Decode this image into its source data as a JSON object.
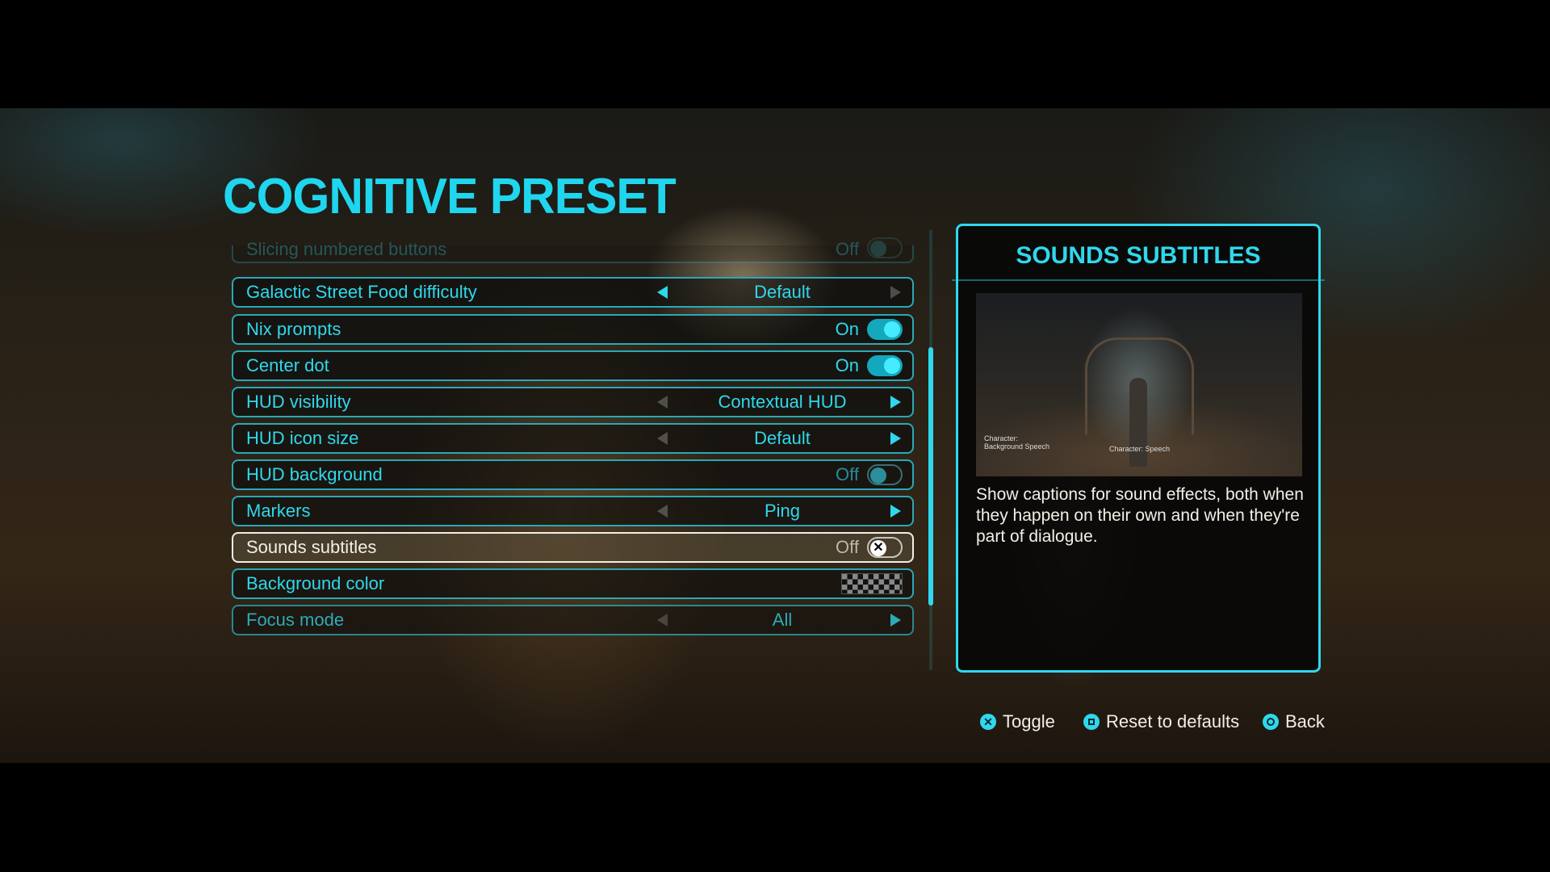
{
  "page": {
    "title": "COGNITIVE PRESET"
  },
  "settings": [
    {
      "label": "Slicing numbered buttons",
      "type": "toggle",
      "state": "Off"
    },
    {
      "label": "Galactic Street Food difficulty",
      "type": "select",
      "value": "Default",
      "left_enabled": true,
      "right_enabled": false
    },
    {
      "label": "Nix prompts",
      "type": "toggle",
      "state": "On"
    },
    {
      "label": "Center dot",
      "type": "toggle",
      "state": "On"
    },
    {
      "label": "HUD visibility",
      "type": "select",
      "value": "Contextual HUD",
      "left_enabled": false,
      "right_enabled": true
    },
    {
      "label": "HUD icon size",
      "type": "select",
      "value": "Default",
      "left_enabled": false,
      "right_enabled": true
    },
    {
      "label": "HUD background",
      "type": "toggle",
      "state": "Off"
    },
    {
      "label": "Markers",
      "type": "select",
      "value": "Ping",
      "left_enabled": false,
      "right_enabled": true
    },
    {
      "label": "Sounds subtitles",
      "type": "toggle",
      "state": "Off",
      "selected": true
    },
    {
      "label": "Background color",
      "type": "color",
      "value": "transparent"
    },
    {
      "label": "Focus mode",
      "type": "select",
      "value": "All",
      "left_enabled": false,
      "right_enabled": true
    }
  ],
  "panel": {
    "title": "SOUNDS SUBTITLES",
    "preview_captions": [
      "Character: Background Speech",
      "Character: Speech"
    ],
    "description": "Show captions for sound effects, both when they happen on their own and when they're part of dialogue."
  },
  "footer": {
    "toggle": "Toggle",
    "reset": "Reset to defaults",
    "back": "Back"
  },
  "colors": {
    "accent": "#2fd8ec",
    "selected": "#f2efe6"
  }
}
